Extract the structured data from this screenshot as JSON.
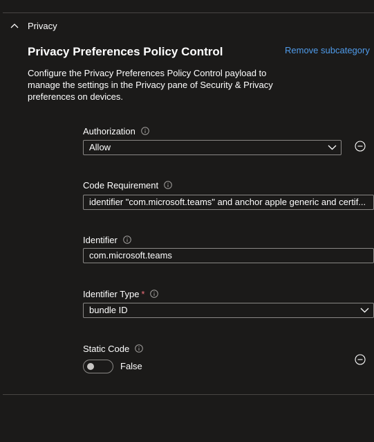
{
  "section": {
    "title": "Privacy"
  },
  "heading": "Privacy Preferences Policy Control",
  "remove_link": "Remove subcategory",
  "description": "Configure the Privacy Preferences Policy Control payload to manage the settings in the Privacy pane of Security & Privacy preferences on devices.",
  "fields": {
    "authorization": {
      "label": "Authorization",
      "value": "Allow"
    },
    "code_requirement": {
      "label": "Code Requirement",
      "value": "identifier \"com.microsoft.teams\" and anchor apple generic and certif..."
    },
    "identifier": {
      "label": "Identifier",
      "value": "com.microsoft.teams"
    },
    "identifier_type": {
      "label": "Identifier Type",
      "required_mark": "*",
      "value": "bundle ID"
    },
    "static_code": {
      "label": "Static Code",
      "value": "False",
      "enabled": false
    }
  },
  "icons": {
    "section_toggle": "chevron-up-icon",
    "info": "info-icon",
    "dropdown": "chevron-down-icon",
    "remove": "minus-circle-icon"
  },
  "colors": {
    "background": "#1b1a19",
    "link": "#4f9bea",
    "required": "#f1707b",
    "border": "#8a8886"
  }
}
